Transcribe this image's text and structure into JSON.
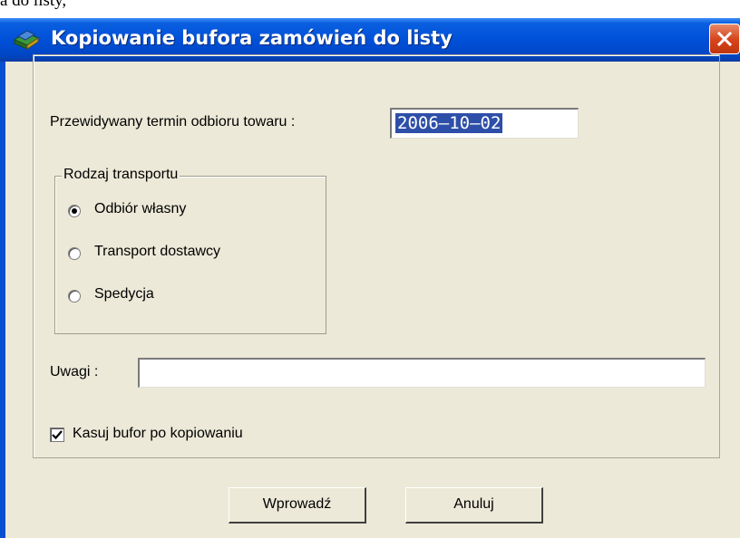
{
  "above_text": "a do listy,",
  "window": {
    "title": "Kopiowanie bufora zamówień do listy"
  },
  "form": {
    "date_label": "Przewidywany termin odbioru towaru :",
    "date_value": "2006–10–02",
    "transport": {
      "legend": "Rodzaj transportu",
      "options": [
        {
          "label": "Odbiór własny",
          "selected": true
        },
        {
          "label": "Transport dostawcy",
          "selected": false
        },
        {
          "label": "Spedycja",
          "selected": false
        }
      ]
    },
    "notes_label": "Uwagi :",
    "notes_value": "",
    "clear_buffer_label": "Kasuj bufor po kopiowaniu",
    "clear_buffer_checked": true
  },
  "buttons": {
    "ok": "Wprowadź",
    "cancel": "Anuluj"
  }
}
